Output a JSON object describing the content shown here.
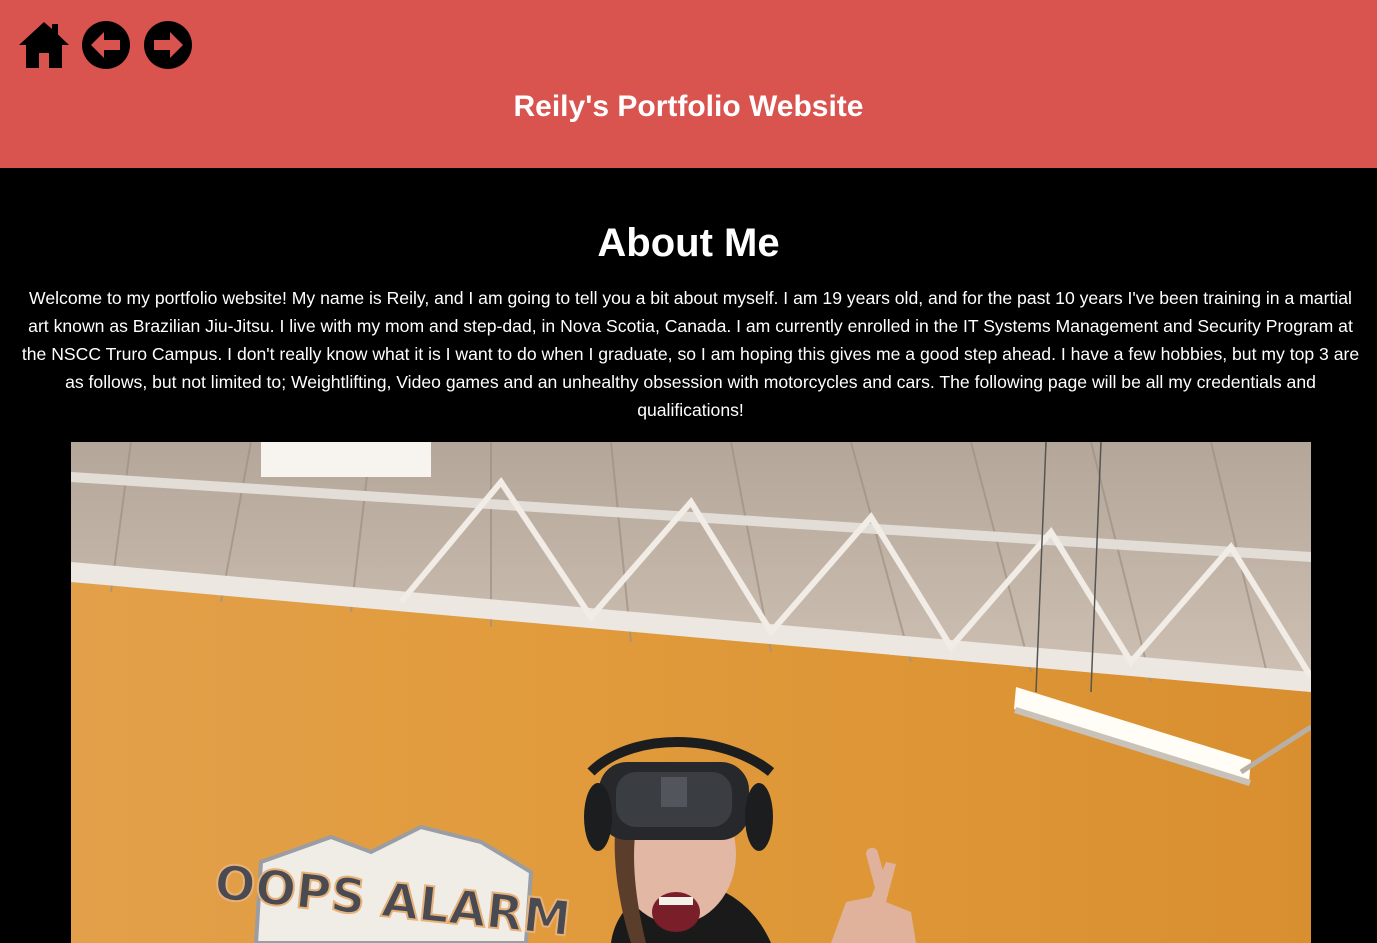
{
  "colors": {
    "header_bg": "#d9534f",
    "page_bg": "#000000",
    "text": "#ffffff",
    "icon": "#000000"
  },
  "nav": {
    "home_icon": "home-icon",
    "back_icon": "arrow-left-circle-icon",
    "forward_icon": "arrow-right-circle-icon"
  },
  "header": {
    "title": "Reily's Portfolio Website"
  },
  "about": {
    "heading": "About Me",
    "body": "Welcome to my portfolio website! My name is Reily, and I am going to tell you a bit about myself. I am 19 years old, and for the past 10 years I've been training in a martial art known as Brazilian Jiu-Jitsu. I live with my mom and step-dad, in Nova Scotia, Canada. I am currently enrolled in the IT Systems Management and Security Program at the NSCC Truro Campus. I don't really know what it is I want to do when I graduate, so I am hoping this gives me a good step ahead. I have a few hobbies, but my top 3 are as follows, but not limited to; Weightlifting, Video games and an unhealthy obsession with motorcycles and cars. The following page will be all my credentials and qualifications!"
  },
  "photo": {
    "sign_text": "OOPS ALARM"
  }
}
